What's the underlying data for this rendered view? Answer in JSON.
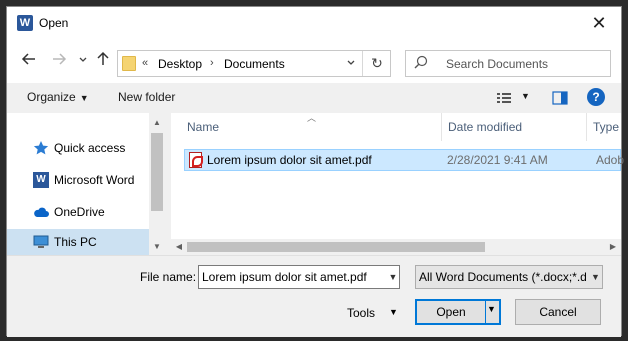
{
  "window": {
    "title": "Open",
    "app_icon": "word-icon",
    "close_glyph": "✕"
  },
  "nav": {
    "back": "back-arrow-icon",
    "forward": "forward-arrow-icon",
    "recent": "chevron-down-icon",
    "up": "up-arrow-icon",
    "overflow": "«",
    "path": [
      "Desktop",
      "Documents"
    ],
    "path_separator": "›",
    "refresh_glyph": "↻"
  },
  "search": {
    "placeholder": "Search Documents"
  },
  "commands": {
    "organize_label": "Organize",
    "new_folder_label": "New folder",
    "help_glyph": "?"
  },
  "sidebar": {
    "items": [
      {
        "label": "Quick access",
        "icon": "star-icon",
        "selected": false
      },
      {
        "label": "Microsoft Word",
        "icon": "word-icon",
        "selected": false
      },
      {
        "label": "OneDrive",
        "icon": "cloud-icon",
        "selected": false
      },
      {
        "label": "This PC",
        "icon": "computer-icon",
        "selected": true
      }
    ]
  },
  "files": {
    "columns": [
      "Name",
      "Date modified",
      "Type"
    ],
    "rows": [
      {
        "name": "Lorem ipsum dolor sit amet.pdf",
        "date_modified": "2/28/2021 9:41 AM",
        "type": "Adob",
        "icon": "pdf-icon",
        "selected": true
      }
    ]
  },
  "footer": {
    "file_name_label": "File name:",
    "file_name_value": "Lorem ipsum dolor sit amet.pdf",
    "filter_value": "All Word Documents (*.docx;*.d",
    "tools_label": "Tools",
    "open_label": "Open",
    "cancel_label": "Cancel"
  },
  "colors": {
    "accent": "#0078d7",
    "selection_fill": "#cce8ff",
    "nav_selected": "#cce1f2",
    "word_blue": "#2b579a"
  }
}
